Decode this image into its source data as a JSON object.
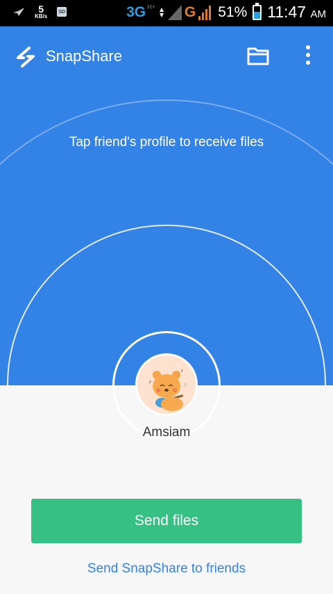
{
  "status_bar": {
    "speed_value": "5",
    "speed_unit": "KB/s",
    "sd_label": "SD",
    "network_3g": "3G",
    "network_hplus": "H+",
    "network_g": "G",
    "battery_percent": "51%",
    "battery_level": 0.51,
    "time": "11:47",
    "ampm": "AM"
  },
  "app_bar": {
    "title": "SnapShare",
    "logo_icon": "lightning-icon",
    "folder_icon": "folder-icon",
    "menu_icon": "more-vert-icon"
  },
  "hero": {
    "hint": "Tap friend's profile to receive files"
  },
  "profile": {
    "name": "Amsiam"
  },
  "actions": {
    "send_files": "Send files",
    "share_app": "Send SnapShare to friends"
  },
  "colors": {
    "primary": "#3382e6",
    "send_button": "#37c084",
    "link": "#3382e6"
  }
}
